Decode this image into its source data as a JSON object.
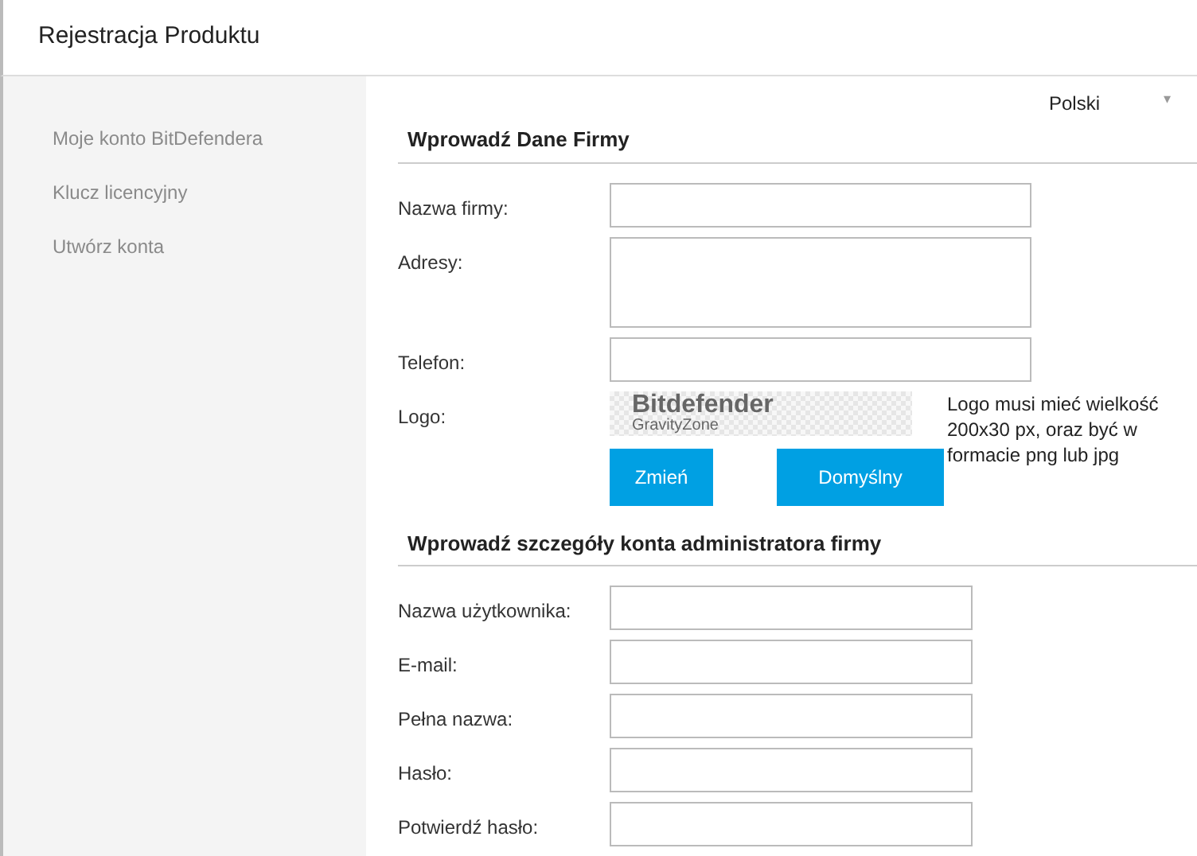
{
  "window": {
    "title": "Rejestracja Produktu"
  },
  "sidebar": {
    "items": [
      {
        "label": "Moje konto BitDefendera"
      },
      {
        "label": "Klucz licencyjny"
      },
      {
        "label": "Utwórz konta"
      }
    ]
  },
  "language": {
    "value": "Polski",
    "caret": "▾"
  },
  "sections": [
    {
      "title": "Wprowadź Dane Firmy",
      "fields": [
        {
          "kind": "text",
          "label": "Nazwa firmy:"
        },
        {
          "kind": "textarea",
          "label": "Adresy:"
        },
        {
          "kind": "text",
          "label": "Telefon:"
        },
        {
          "kind": "logo",
          "label": "Logo:",
          "logo_title": "Bitdefender",
          "logo_subtitle": "GravityZone",
          "hint": "Logo musi mieć wielkość 200x30 px, oraz być w formacie png lub jpg",
          "buttons": [
            "Zmień",
            "Domyślny"
          ]
        }
      ]
    },
    {
      "title": "Wprowadź szczegóły konta administratora firmy",
      "fields": [
        {
          "kind": "short",
          "label": "Nazwa użytkownika:"
        },
        {
          "kind": "short",
          "label": "E-mail:"
        },
        {
          "kind": "short",
          "label": "Pełna nazwa:"
        },
        {
          "kind": "short",
          "label": "Hasło:"
        },
        {
          "kind": "short",
          "label": "Potwierdź hasło:"
        }
      ]
    }
  ]
}
